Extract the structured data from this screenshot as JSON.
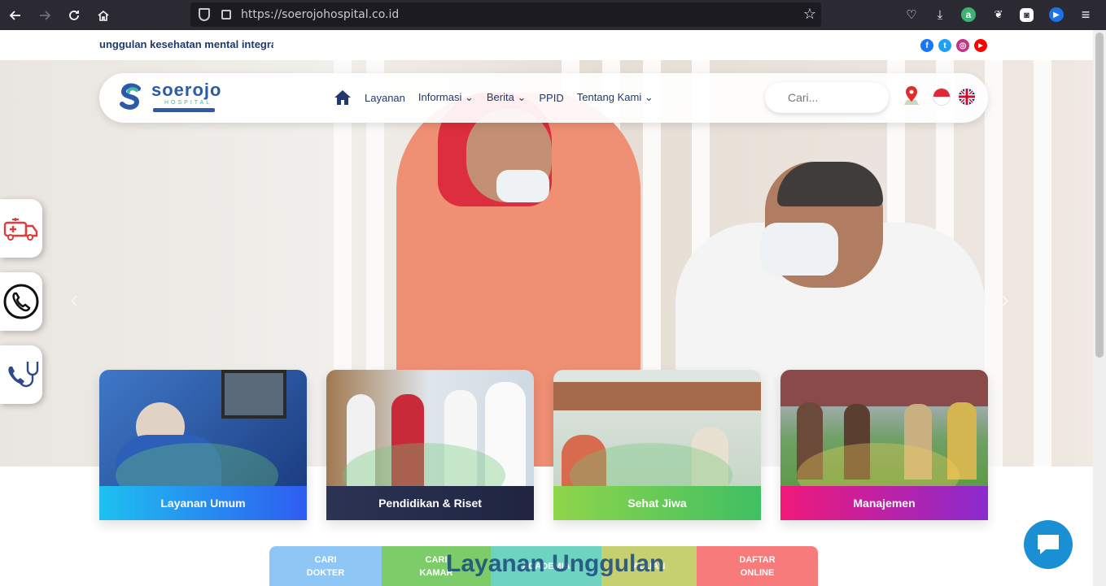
{
  "browser": {
    "url": "https://soerojohospital.co.id",
    "back_icon": "arrow-left",
    "forward_icon": "arrow-right",
    "reload_icon": "reload",
    "home_icon": "home"
  },
  "topbar": {
    "ticker": "unggulan kesehatan mental integral",
    "social": [
      {
        "name": "facebook",
        "glyph": "f",
        "color": "#1877f2"
      },
      {
        "name": "twitter",
        "glyph": "t",
        "color": "#1da1f2"
      },
      {
        "name": "instagram",
        "glyph": "◎",
        "color": "#c13584"
      },
      {
        "name": "youtube",
        "glyph": "▶",
        "color": "#ff0000"
      }
    ]
  },
  "nav": {
    "logo_text": "soerojo",
    "logo_sub": "HOSPITAL",
    "menu": [
      {
        "label": "Layanan",
        "dropdown": false
      },
      {
        "label": "Informasi",
        "dropdown": true
      },
      {
        "label": "Berita",
        "dropdown": true
      },
      {
        "label": "PPID",
        "dropdown": false
      },
      {
        "label": "Tentang Kami",
        "dropdown": true
      }
    ],
    "search_placeholder": "Cari..."
  },
  "side_buttons": [
    "ambulance-icon",
    "phone-icon",
    "stethoscope-phone-icon"
  ],
  "cards": [
    {
      "label": "Layanan Umum",
      "from": "#1ec0f0",
      "to": "#2f5cf0"
    },
    {
      "label": "Pendidikan & Riset",
      "from": "#2c3354",
      "to": "#1f2540"
    },
    {
      "label": "Sehat Jiwa",
      "from": "#8fd64a",
      "to": "#3fbf63"
    },
    {
      "label": "Manajemen",
      "from": "#f0197a",
      "to": "#8a2ad0"
    }
  ],
  "section_title": "Layanan Unggulan",
  "quick_links": [
    {
      "line1": "CARI",
      "line2": "DOKTER",
      "color": "#8ec6f5"
    },
    {
      "line1": "CARI",
      "line2": "KAMAR",
      "color": "#7ccc6a"
    },
    {
      "line1": "ACADEMIA",
      "line2": "",
      "color": "#6fd3c2"
    },
    {
      "line1": "ADUAN",
      "line2": "",
      "color": "#c7d070"
    },
    {
      "line1": "DAFTAR",
      "line2": "ONLINE",
      "color": "#f77b7b"
    }
  ]
}
